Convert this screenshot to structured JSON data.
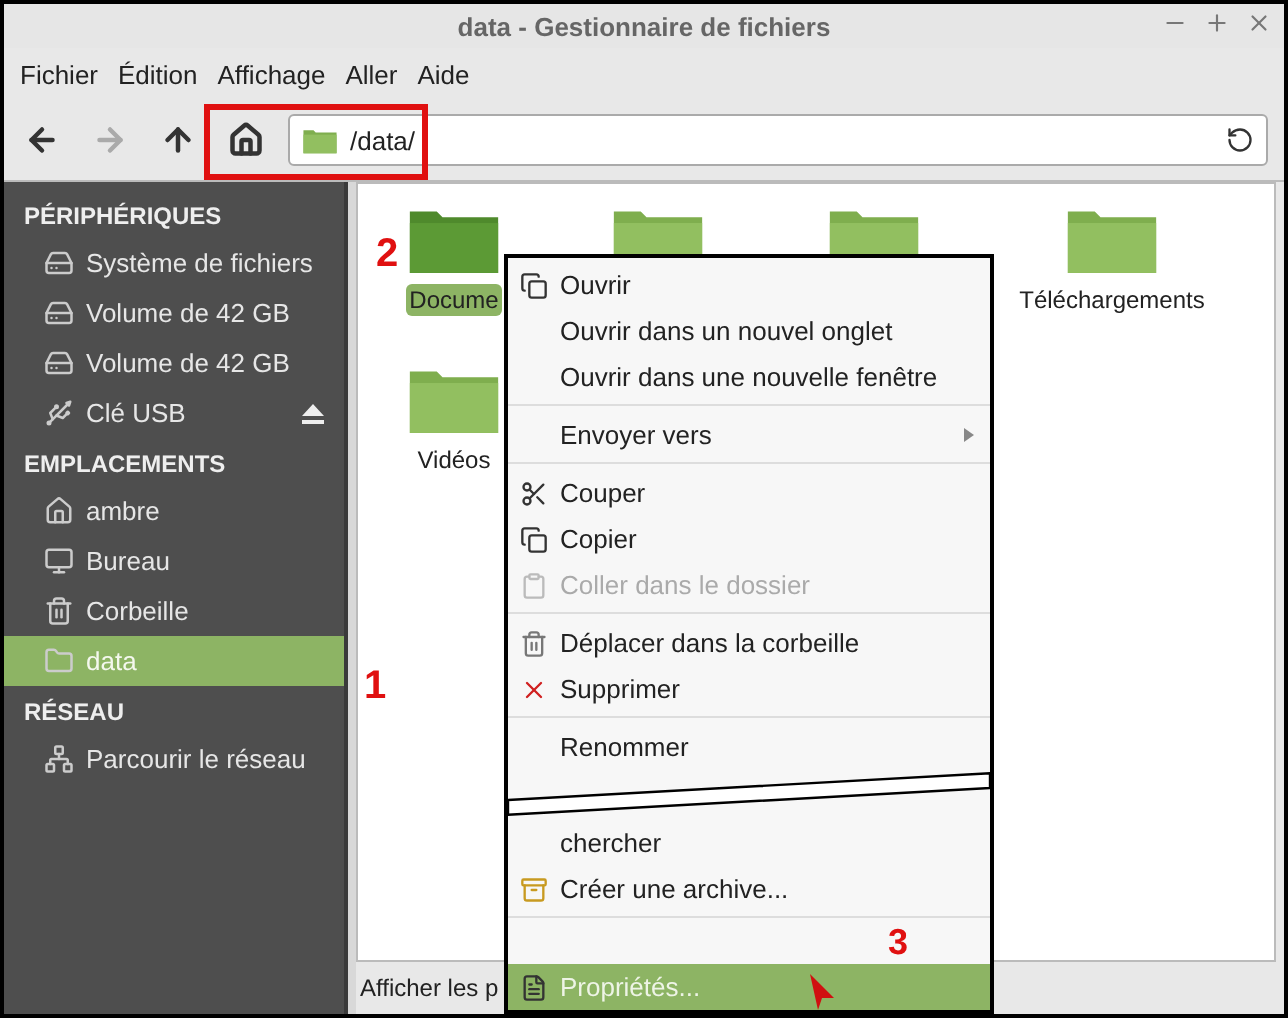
{
  "window": {
    "title": "data - Gestionnaire de fichiers"
  },
  "menubar": [
    "Fichier",
    "Édition",
    "Affichage",
    "Aller",
    "Aide"
  ],
  "toolbar": {
    "buttons": [
      {
        "disabled": false
      },
      {
        "disabled": true
      },
      {
        "disabled": false
      },
      {
        "disabled": false
      }
    ],
    "address": "/data/"
  },
  "sidebar": [
    {
      "heading": "PÉRIPHÉRIQUES",
      "items": [
        {
          "label": "Système de fichiers",
          "selected": false,
          "eject": false
        },
        {
          "label": "Volume de 42 GB",
          "selected": false,
          "eject": false
        },
        {
          "label": "Volume de 42 GB",
          "selected": false,
          "eject": false
        },
        {
          "label": "Clé USB",
          "selected": false,
          "eject": true
        }
      ]
    },
    {
      "heading": "EMPLACEMENTS",
      "items": [
        {
          "label": "ambre",
          "selected": false,
          "eject": false
        },
        {
          "label": "Bureau",
          "selected": false,
          "eject": false
        },
        {
          "label": "Corbeille",
          "selected": false,
          "eject": false
        },
        {
          "label": "data",
          "selected": true,
          "eject": false
        }
      ]
    },
    {
      "heading": "RÉSEAU",
      "items": [
        {
          "label": "Parcourir le réseau",
          "selected": false,
          "eject": false
        }
      ]
    }
  ],
  "folders": [
    {
      "label": "Docume",
      "selected": true
    },
    {
      "selected": false
    },
    {
      "selected": false
    },
    {
      "label": "Téléchargements",
      "selected": false
    },
    {
      "label": "Vidéos",
      "selected": false
    }
  ],
  "status_bar": "Afficher les p",
  "context_menu": [
    {
      "kind": "item",
      "label": "Ouvrir",
      "disabled": false,
      "selected": false,
      "submenu": false
    },
    {
      "kind": "item",
      "label": "Ouvrir dans un nouvel onglet",
      "disabled": false,
      "selected": false,
      "submenu": false
    },
    {
      "kind": "item",
      "label": "Ouvrir dans une nouvelle fenêtre",
      "disabled": false,
      "selected": false,
      "submenu": false
    },
    {
      "kind": "separator"
    },
    {
      "kind": "item",
      "label": "Envoyer vers",
      "disabled": false,
      "selected": false,
      "submenu": true
    },
    {
      "kind": "separator"
    },
    {
      "kind": "item",
      "label": "Couper",
      "disabled": false,
      "selected": false,
      "submenu": false
    },
    {
      "kind": "item",
      "label": "Copier",
      "disabled": false,
      "selected": false,
      "submenu": false
    },
    {
      "kind": "item",
      "label": "Coller dans le dossier",
      "disabled": true,
      "selected": false,
      "submenu": false
    },
    {
      "kind": "separator"
    },
    {
      "kind": "item",
      "label": "Déplacer dans la corbeille",
      "disabled": false,
      "selected": false,
      "submenu": false
    },
    {
      "kind": "item",
      "label": "Supprimer",
      "disabled": false,
      "selected": false,
      "submenu": false
    },
    {
      "kind": "separator"
    },
    {
      "kind": "item",
      "label": "Renommer",
      "disabled": false,
      "selected": false,
      "submenu": false
    },
    {
      "kind": "stripe"
    },
    {
      "kind": "item",
      "label": "chercher",
      "disabled": false,
      "selected": false,
      "submenu": false
    },
    {
      "kind": "item",
      "label": "Créer une archive...",
      "disabled": false,
      "selected": false,
      "submenu": false
    },
    {
      "kind": "separator"
    },
    {
      "kind": "item",
      "label": "Propriétés...",
      "disabled": false,
      "selected": true,
      "submenu": false
    }
  ],
  "annotations": [
    "1",
    "2",
    "3"
  ]
}
